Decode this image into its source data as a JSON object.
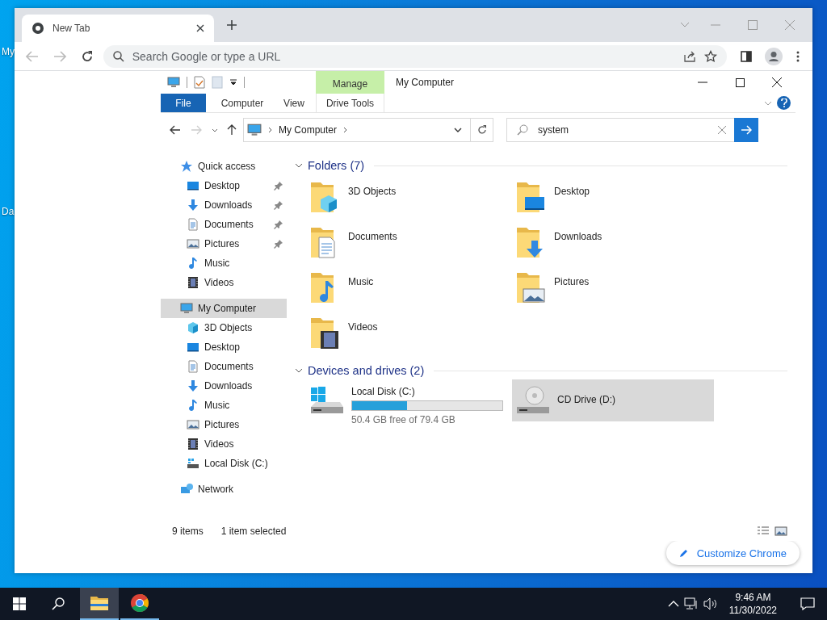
{
  "desktop_icons": [
    {
      "label": "My"
    },
    {
      "label": "Da"
    }
  ],
  "browser": {
    "tabs": [
      {
        "title": "New Tab",
        "selected": true
      }
    ],
    "address_bar": {
      "placeholder": "Search Google or type a URL"
    },
    "customize_button": {
      "label": "Customize Chrome"
    }
  },
  "explorer": {
    "title": "My Computer",
    "ribbon_tabs": [
      {
        "label": "File",
        "kind": "file",
        "selected": false
      },
      {
        "label": "Computer",
        "kind": "tab",
        "selected": false
      },
      {
        "label": "View",
        "kind": "tab",
        "selected": false
      },
      {
        "label": "Drive Tools",
        "kind": "contextual",
        "group": "Manage",
        "selected": false
      }
    ],
    "address": {
      "path": [
        "My Computer"
      ]
    },
    "search": {
      "value": "system"
    },
    "nav": [
      {
        "label": "Quick access",
        "kind": "star",
        "selected": false,
        "children": [
          {
            "label": "Desktop",
            "kind": "desktop",
            "pinned": true,
            "selected": false
          },
          {
            "label": "Downloads",
            "kind": "download",
            "pinned": true,
            "selected": false
          },
          {
            "label": "Documents",
            "kind": "document",
            "pinned": true,
            "selected": false
          },
          {
            "label": "Pictures",
            "kind": "picture",
            "pinned": true,
            "selected": false
          },
          {
            "label": "Music",
            "kind": "music",
            "pinned": false,
            "selected": false
          },
          {
            "label": "Videos",
            "kind": "video",
            "pinned": false,
            "selected": false
          }
        ]
      },
      {
        "label": "My Computer",
        "kind": "computer",
        "selected": true,
        "children": [
          {
            "label": "3D Objects",
            "kind": "cube",
            "pinned": false,
            "selected": false
          },
          {
            "label": "Desktop",
            "kind": "desktop",
            "pinned": false,
            "selected": false
          },
          {
            "label": "Documents",
            "kind": "document",
            "pinned": false,
            "selected": false
          },
          {
            "label": "Downloads",
            "kind": "download",
            "pinned": false,
            "selected": false
          },
          {
            "label": "Music",
            "kind": "music",
            "pinned": false,
            "selected": false
          },
          {
            "label": "Pictures",
            "kind": "picture",
            "pinned": false,
            "selected": false
          },
          {
            "label": "Videos",
            "kind": "video",
            "pinned": false,
            "selected": false
          },
          {
            "label": "Local Disk (C:)",
            "kind": "disk",
            "pinned": false,
            "selected": false
          }
        ]
      },
      {
        "label": "Network",
        "kind": "network",
        "selected": false
      }
    ],
    "groups": [
      {
        "title": "Folders (7)",
        "expanded": true,
        "items": [
          {
            "kind": "cube",
            "name": "3D Objects",
            "selected": false
          },
          {
            "kind": "desktop",
            "name": "Desktop",
            "selected": false
          },
          {
            "kind": "document",
            "name": "Documents",
            "selected": false
          },
          {
            "kind": "download",
            "name": "Downloads",
            "selected": false
          },
          {
            "kind": "music",
            "name": "Music",
            "selected": false
          },
          {
            "kind": "picture",
            "name": "Pictures",
            "selected": false
          },
          {
            "kind": "video",
            "name": "Videos",
            "selected": false
          }
        ]
      },
      {
        "title": "Devices and drives (2)",
        "expanded": true,
        "items": [
          {
            "kind": "disk",
            "name": "Local Disk (C:)",
            "level": 0.365,
            "free": "50.4 GB free of 79.4 GB",
            "selected": false
          },
          {
            "kind": "cd",
            "name": "CD Drive (D:)",
            "selected": true
          }
        ]
      }
    ],
    "status": {
      "items": "9 items",
      "selection": "1 item selected"
    }
  },
  "taskbar": {
    "apps": [
      {
        "kind": "explorer",
        "active": true
      },
      {
        "kind": "chrome",
        "active": false
      }
    ],
    "time": "9:46 AM",
    "date": "11/30/2022"
  }
}
